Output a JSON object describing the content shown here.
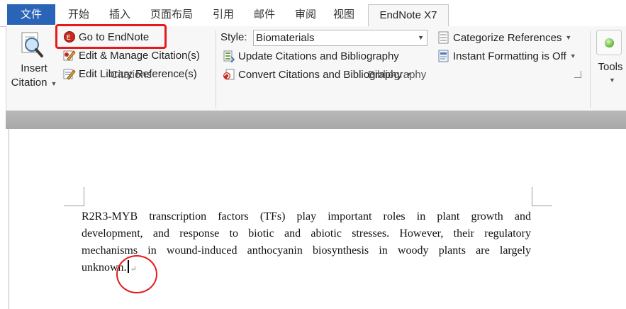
{
  "tabs": {
    "file": "文件",
    "items": [
      "开始",
      "插入",
      "页面布局",
      "引用",
      "邮件",
      "审阅",
      "视图"
    ],
    "active": "EndNote X7"
  },
  "citations": {
    "group_label": "Citations",
    "insert_line1": "Insert",
    "insert_line2": "Citation",
    "goto": "Go to EndNote",
    "edit_manage": "Edit & Manage Citation(s)",
    "edit_library": "Edit Library Reference(s)"
  },
  "bibliography": {
    "group_label": "Bibliography",
    "style_label": "Style:",
    "style_value": "Biomaterials",
    "update": "Update Citations and Bibliography",
    "convert": "Convert Citations and Bibliography",
    "categorize": "Categorize References",
    "instant": "Instant Formatting is Off"
  },
  "tools": {
    "label": "Tools"
  },
  "document": {
    "lines": [
      "R2R3-MYB transcription factors (TFs) play important roles in plant growth and",
      "development, and response to biotic and abiotic stresses. However, their regulatory",
      "mechanisms in wound-induced anthocyanin biosynthesis in woody plants are largely",
      "unknown."
    ]
  },
  "colors": {
    "file_tab": "#2a64b6",
    "annotation_red": "#e51b1b",
    "ribbon_bg": "#f7f7f7"
  }
}
